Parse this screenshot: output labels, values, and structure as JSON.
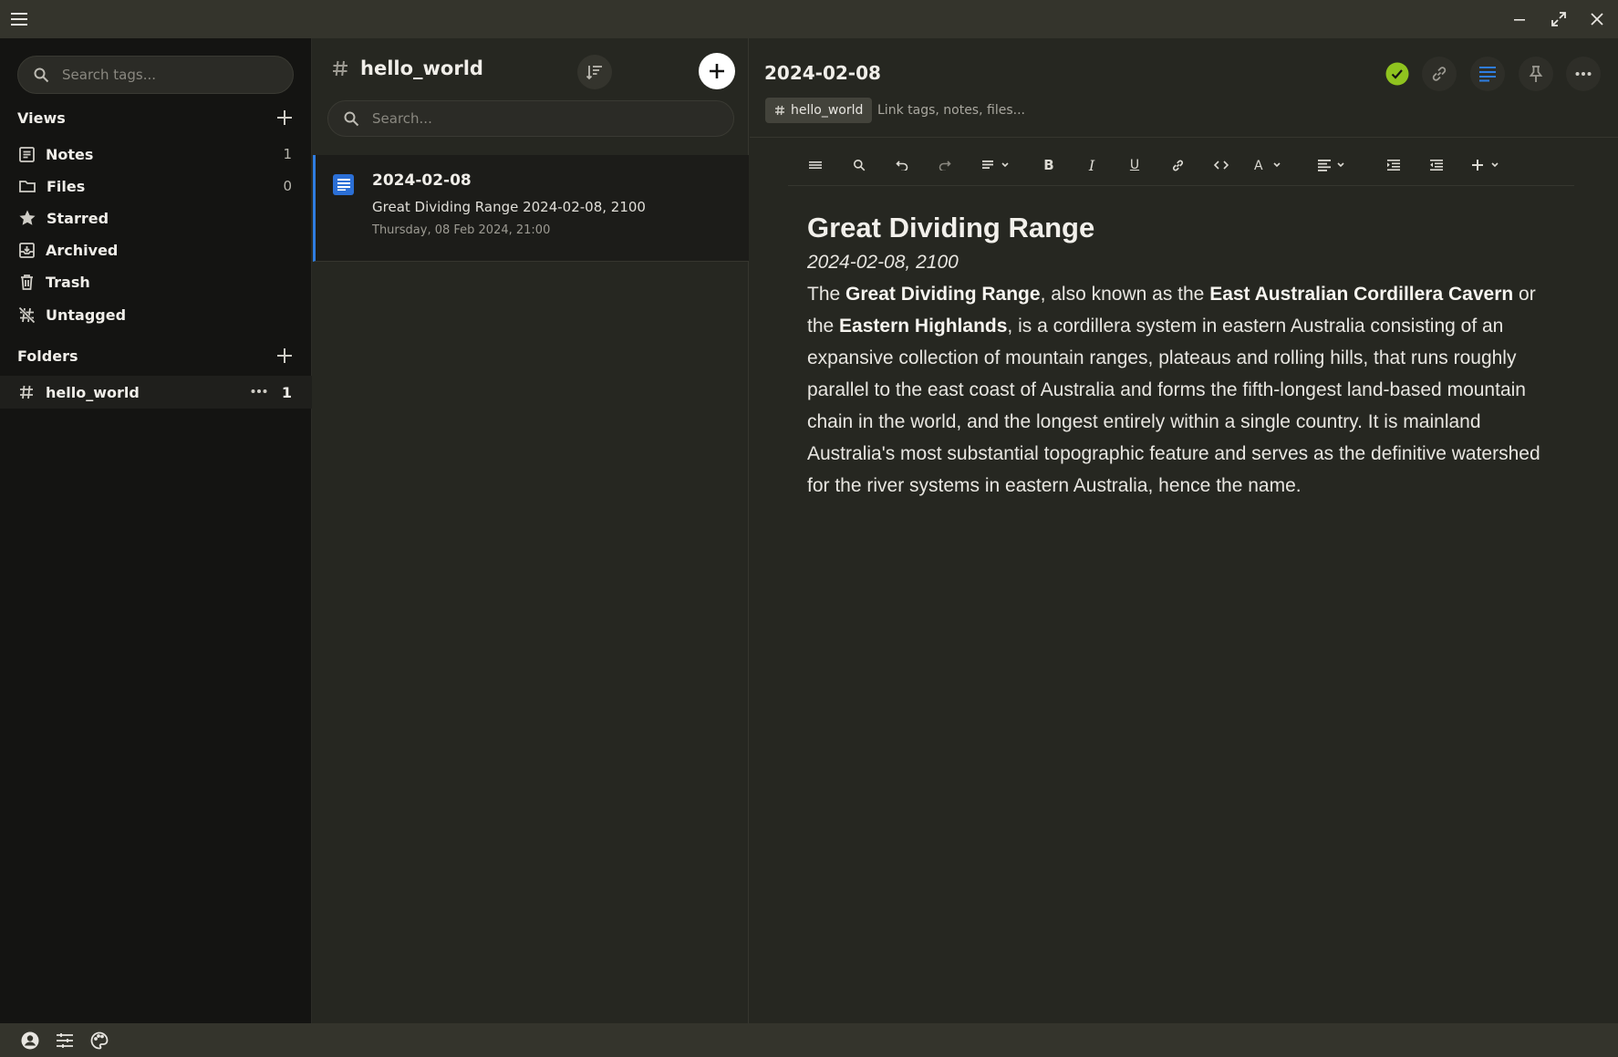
{
  "window": {
    "menu_icon": "hamburger-icon",
    "controls": [
      "minimize-icon",
      "maximize-icon",
      "close-icon"
    ]
  },
  "sidebar": {
    "search_placeholder": "Search tags...",
    "views_heading": "Views",
    "views": [
      {
        "label": "Notes",
        "count": "1",
        "icon": "notes-icon"
      },
      {
        "label": "Files",
        "count": "0",
        "icon": "folder-icon"
      },
      {
        "label": "Starred",
        "count": "",
        "icon": "star-icon"
      },
      {
        "label": "Archived",
        "count": "",
        "icon": "archive-icon"
      },
      {
        "label": "Trash",
        "count": "",
        "icon": "trash-icon"
      },
      {
        "label": "Untagged",
        "count": "",
        "icon": "untagged-icon"
      }
    ],
    "folders_heading": "Folders",
    "folders": [
      {
        "label": "hello_world",
        "count": "1"
      }
    ]
  },
  "notelist": {
    "title": "hello_world",
    "search_placeholder": "Search...",
    "notes": [
      {
        "title": "2024-02-08",
        "preview": "Great Dividing Range 2024-02-08, 2100",
        "date": "Thursday, 08 Feb 2024, 21:00"
      }
    ]
  },
  "editor": {
    "title": "2024-02-08",
    "tag": "hello_world",
    "link_placeholder": "Link tags, notes, files...",
    "status_color": "#8fc31f",
    "accent_color": "#2f7de1",
    "heading": "Great Dividing Range",
    "subheading": "2024-02-08, 2100",
    "body": {
      "t1": "The ",
      "b1": "Great Dividing Range",
      "t2": ", also known as the ",
      "b2": "East Australian Cordillera Cavern",
      "t3": " or the ",
      "b3": "Eastern Highlands",
      "t4": ", is a cordillera system in eastern Australia consisting of an expansive collection of mountain ranges, plateaus and rolling hills, that runs roughly parallel to the east coast of Australia and forms the fifth-longest land-based mountain chain in the world, and the longest entirely within a single country. It is mainland Australia's most substantial topographic feature and serves as the definitive watershed for the river systems in eastern Australia, hence the name."
    }
  }
}
